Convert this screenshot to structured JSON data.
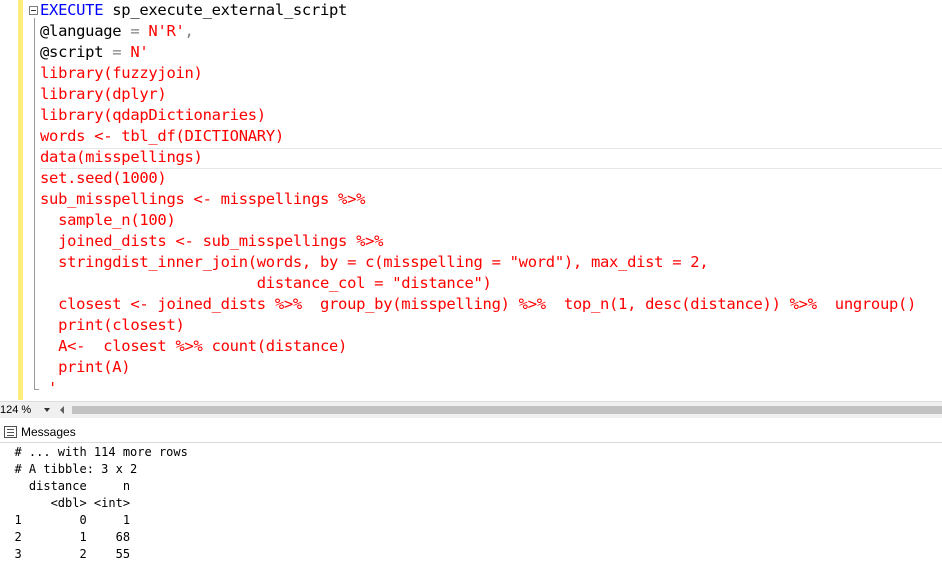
{
  "editor": {
    "lines": [
      {
        "segments": [
          {
            "text": "EXECUTE",
            "color": "kw"
          },
          {
            "text": " sp_execute_external_script",
            "color": "blk"
          }
        ]
      },
      {
        "segments": [
          {
            "text": "@language",
            "color": "blk"
          },
          {
            "text": " = ",
            "color": "gry"
          },
          {
            "text": "N'R'",
            "color": "red"
          },
          {
            "text": ",",
            "color": "gry"
          }
        ]
      },
      {
        "segments": [
          {
            "text": "@script",
            "color": "blk"
          },
          {
            "text": " = ",
            "color": "gry"
          },
          {
            "text": "N'",
            "color": "red"
          }
        ]
      },
      {
        "segments": [
          {
            "text": "library(fuzzyjoin)",
            "color": "red"
          }
        ]
      },
      {
        "segments": [
          {
            "text": "library(dplyr)",
            "color": "red"
          }
        ]
      },
      {
        "segments": [
          {
            "text": "library(qdapDictionaries)",
            "color": "red"
          }
        ]
      },
      {
        "segments": [
          {
            "text": "words <- tbl_df(DICTIONARY)",
            "color": "red"
          }
        ]
      },
      {
        "segments": [
          {
            "text": "data(misspellings)",
            "color": "red"
          }
        ]
      },
      {
        "segments": [
          {
            "text": "set.seed(1000)",
            "color": "red"
          }
        ]
      },
      {
        "segments": [
          {
            "text": "sub_misspellings <- misspellings %>%",
            "color": "red"
          }
        ]
      },
      {
        "segments": [
          {
            "text": "  sample_n(100)",
            "color": "red"
          }
        ]
      },
      {
        "segments": [
          {
            "text": "  joined_dists <- sub_misspellings %>%",
            "color": "red"
          }
        ]
      },
      {
        "segments": [
          {
            "text": "  stringdist_inner_join(words, by = c(misspelling = \"word\"), max_dist = 2,",
            "color": "red"
          }
        ]
      },
      {
        "segments": [
          {
            "text": "                        distance_col = \"distance\")",
            "color": "red"
          }
        ]
      },
      {
        "segments": [
          {
            "text": "  closest <- joined_dists %>%  group_by(misspelling) %>%  top_n(1, desc(distance)) %>%  ungroup()",
            "color": "red"
          }
        ]
      },
      {
        "segments": [
          {
            "text": "  print(closest)",
            "color": "red"
          }
        ]
      },
      {
        "segments": [
          {
            "text": "  A<-  closest %>% count(distance)",
            "color": "red"
          }
        ]
      },
      {
        "segments": [
          {
            "text": "  print(A)",
            "color": "red"
          }
        ]
      },
      {
        "segments": [
          {
            "text": "'",
            "color": "red"
          }
        ]
      }
    ]
  },
  "statusbar": {
    "zoom": "124 %"
  },
  "results": {
    "tab_label": "Messages",
    "lines": [
      "  # ... with 114 more rows",
      "  # A tibble: 3 x 2",
      "    distance     n",
      "       <dbl> <int>",
      "  1        0     1",
      "  2        1    68",
      "  3        2    55"
    ]
  }
}
